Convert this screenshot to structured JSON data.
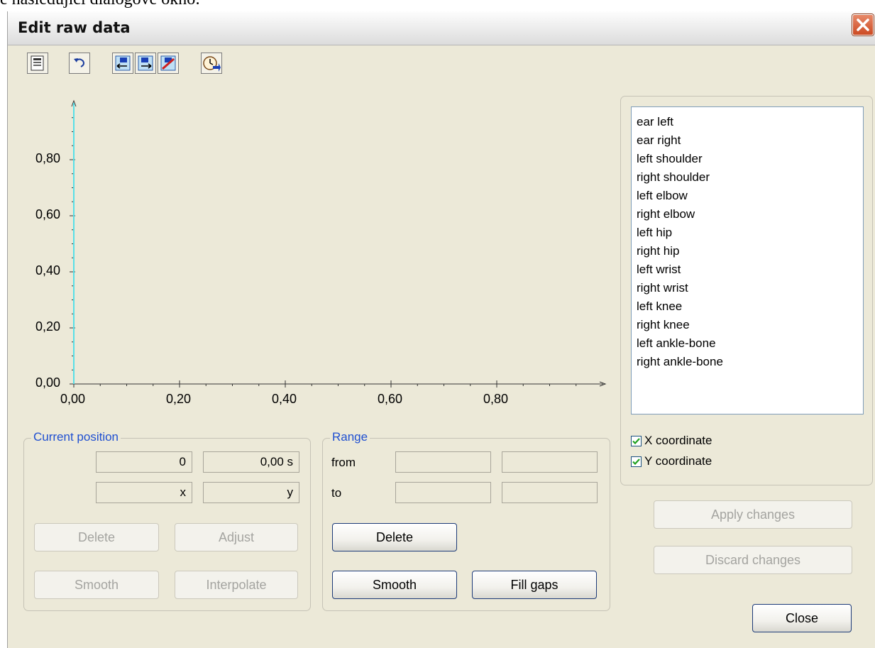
{
  "page_caption": "e následující dialogové okno:",
  "window": {
    "title": "Edit raw data"
  },
  "toolbar": {
    "buttons": [
      {
        "icon": "properties-icon"
      },
      {
        "icon": "undo-icon"
      },
      {
        "icon": "insert-left-icon"
      },
      {
        "icon": "insert-right-icon"
      },
      {
        "icon": "delete-marker-icon"
      },
      {
        "icon": "time-settings-icon"
      }
    ]
  },
  "chart_data": {
    "type": "line",
    "x_ticks": [
      "0,00",
      "0,20",
      "0,40",
      "0,60",
      "0,80"
    ],
    "y_ticks": [
      "0,00",
      "0,20",
      "0,40",
      "0,60",
      "0,80"
    ],
    "xlim": [
      0,
      1
    ],
    "ylim": [
      0,
      1
    ],
    "series": [],
    "cursor_x": 0,
    "cursor_color": "#58e0e8",
    "grid": false
  },
  "current_position": {
    "legend": "Current position",
    "frame": "0",
    "time": "0,00 s",
    "x": "x",
    "y": "y",
    "delete_label": "Delete",
    "adjust_label": "Adjust",
    "smooth_label": "Smooth",
    "interpolate_label": "Interpolate"
  },
  "range": {
    "legend": "Range",
    "from_label": "from",
    "to_label": "to",
    "from_1": "",
    "from_2": "",
    "to_1": "",
    "to_2": "",
    "delete_label": "Delete",
    "smooth_label": "Smooth",
    "fill_gaps_label": "Fill gaps"
  },
  "markers": {
    "items": [
      "ear left",
      "ear right",
      "left shoulder",
      "right shoulder",
      "left elbow",
      "right elbow",
      "left hip",
      "right hip",
      "left wrist",
      "right wrist",
      "left knee",
      "right knee",
      "left ankle-bone",
      "right ankle-bone"
    ],
    "x_coordinate_label": "X coordinate",
    "x_checked": true,
    "y_coordinate_label": "Y coordinate",
    "y_checked": true
  },
  "actions": {
    "apply_label": "Apply changes",
    "discard_label": "Discard changes",
    "close_label": "Close"
  },
  "colors": {
    "accent": "#1f4fd1",
    "check": "#21a121",
    "close_x": "#cc4a22"
  }
}
